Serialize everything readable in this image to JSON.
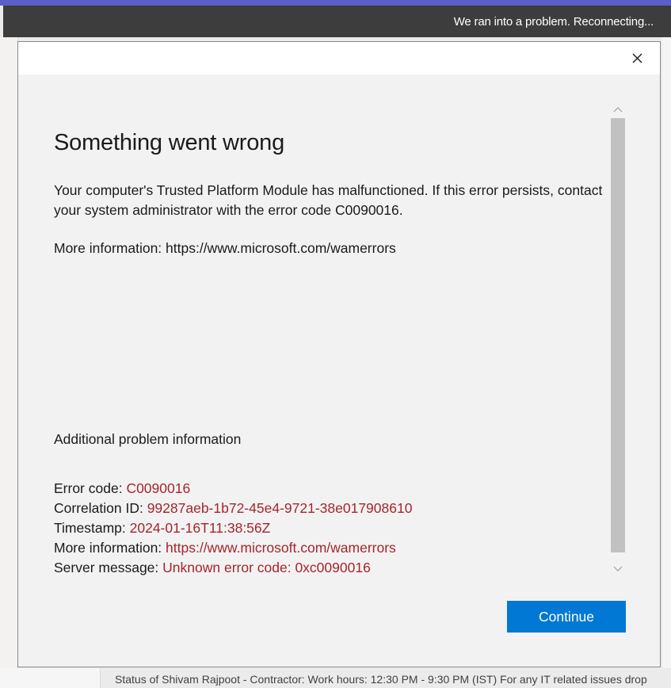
{
  "connection_banner": {
    "text": "We ran into a problem. Reconnecting..."
  },
  "dialog": {
    "heading": "Something went wrong",
    "message": "Your computer's Trusted Platform Module has malfunctioned. If this error persists, contact your system administrator with the error code C0090016.",
    "more_information": "More information: https://www.microsoft.com/wamerrors",
    "additional_title": "Additional problem information",
    "details": [
      {
        "label": "Error code: ",
        "value": "C0090016"
      },
      {
        "label": "Correlation ID: ",
        "value": "99287aeb-1b72-45e4-9721-38e017908610"
      },
      {
        "label": "Timestamp: ",
        "value": "2024-01-16T11:38:56Z"
      },
      {
        "label": "More information: ",
        "value": "https://www.microsoft.com/wamerrors"
      },
      {
        "label": "Server message: ",
        "value": "Unknown error code: 0xc0090016"
      }
    ],
    "continue_label": "Continue",
    "close_icon": "close-icon"
  },
  "status_bar": {
    "text": "Status of Shivam Rajpoot - Contractor: Work hours: 12:30 PM - 9:30 PM (IST)  For any IT related issues drop"
  },
  "colors": {
    "accent": "#5b5fc7",
    "button": "#0078d4",
    "error_value": "#a4262c",
    "banner": "#3d3d3d"
  }
}
